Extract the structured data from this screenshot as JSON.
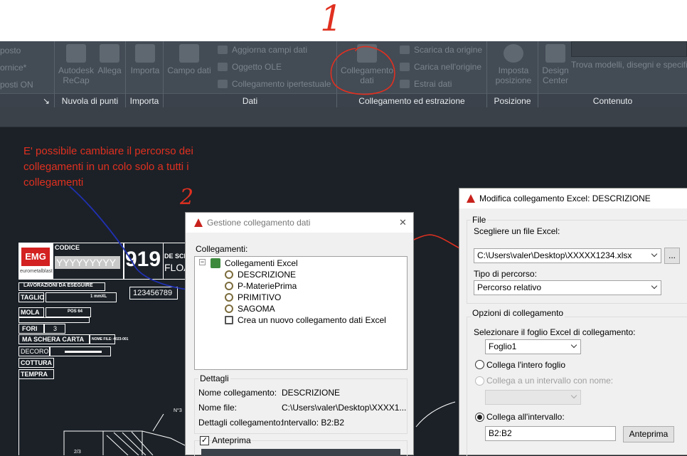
{
  "annotation": {
    "num1": "1",
    "num2": "2",
    "text": "E' possibile cambiare il percorso dei collegamenti in un colo solo a tutti i collegamenti",
    "color": "#e03020",
    "curve_color": "#2030b0"
  },
  "ribbon": {
    "left_partial": [
      "posto",
      "ornice*",
      "posti ON"
    ],
    "cloud": {
      "btn1": "Autodesk ReCap",
      "btn2": "Allega",
      "label": "Nuvola di punti"
    },
    "import": {
      "btn": "Importa",
      "label": "Importa"
    },
    "data": {
      "btn": "Campo dati",
      "items": [
        "Aggiorna campi dati",
        "Oggetto OLE",
        "Collegamento ipertestuale"
      ],
      "label": "Dati"
    },
    "link": {
      "btn": "Collegamento dati",
      "items": [
        "Scarica da origine",
        "Carica nell'origine",
        "Estrai  dati"
      ],
      "label": "Collegamento ed estrazione"
    },
    "position": {
      "btn": "Imposta posizione",
      "label": "Posizione"
    },
    "content": {
      "btn": "Design Center",
      "search_placeholder": "Trova modelli, disegni e specifi",
      "label": "Contenuto"
    }
  },
  "drawing": {
    "logo": "EMG",
    "logo_sub": "eurometalblast",
    "codice_label": "CODICE",
    "codice_value": "YYYYYYYYY",
    "big_number": "919",
    "desc": "DE SCR",
    "float": "FLOAT",
    "number_box": "123456789",
    "rows": [
      "LAVORAZIONI DA ESEGUIRE",
      "TAGLIO",
      "MOLA",
      "FORI",
      "MA SCHERA CARTA",
      "DECORO",
      "COTTURA",
      "TEMPRA"
    ],
    "fori_value": "3",
    "nome_file": "NOME FILE: 4023-001",
    "small1": "1 mmXL",
    "small2": "POS 64",
    "dim1": "N°3",
    "dim2": "2/3"
  },
  "dialog_gestione": {
    "title": "Gestione collegamento dati",
    "close": "✕",
    "links_label": "Collegamenti:",
    "root": "Collegamenti Excel",
    "items": [
      "DESCRIZIONE",
      "P-MateriePrima",
      "PRIMITIVO",
      "SAGOMA"
    ],
    "create": "Crea un nuovo collegamento dati Excel",
    "details_title": "Dettagli",
    "details": [
      {
        "k": "Nome collegamento:",
        "v": "DESCRIZIONE"
      },
      {
        "k": "Nome file:",
        "v": "C:\\Users\\valer\\Desktop\\XXXX1..."
      },
      {
        "k": "Dettagli collegamento:",
        "v": "Intervallo: B2:B2"
      }
    ],
    "preview_label": "Anteprima"
  },
  "dialog_modifica": {
    "title": "Modifica collegamento Excel: DESCRIZIONE",
    "file_group": "File",
    "choose_file": "Scegliere un file Excel:",
    "file_value": "C:\\Users\\valer\\Desktop\\XXXXX1234.xlsx",
    "browse": "...",
    "path_type_label": "Tipo di percorso:",
    "path_type_value": "Percorso relativo",
    "options_group": "Opzioni di collegamento",
    "sheet_label": "Selezionare il foglio Excel di collegamento:",
    "sheet_value": "Foglio1",
    "opt1": "Collega l'intero foglio",
    "opt2": "Collega a un intervallo con nome:",
    "opt3": "Collega all'intervallo:",
    "range_value": "B2:B2",
    "preview_btn": "Anteprima"
  }
}
